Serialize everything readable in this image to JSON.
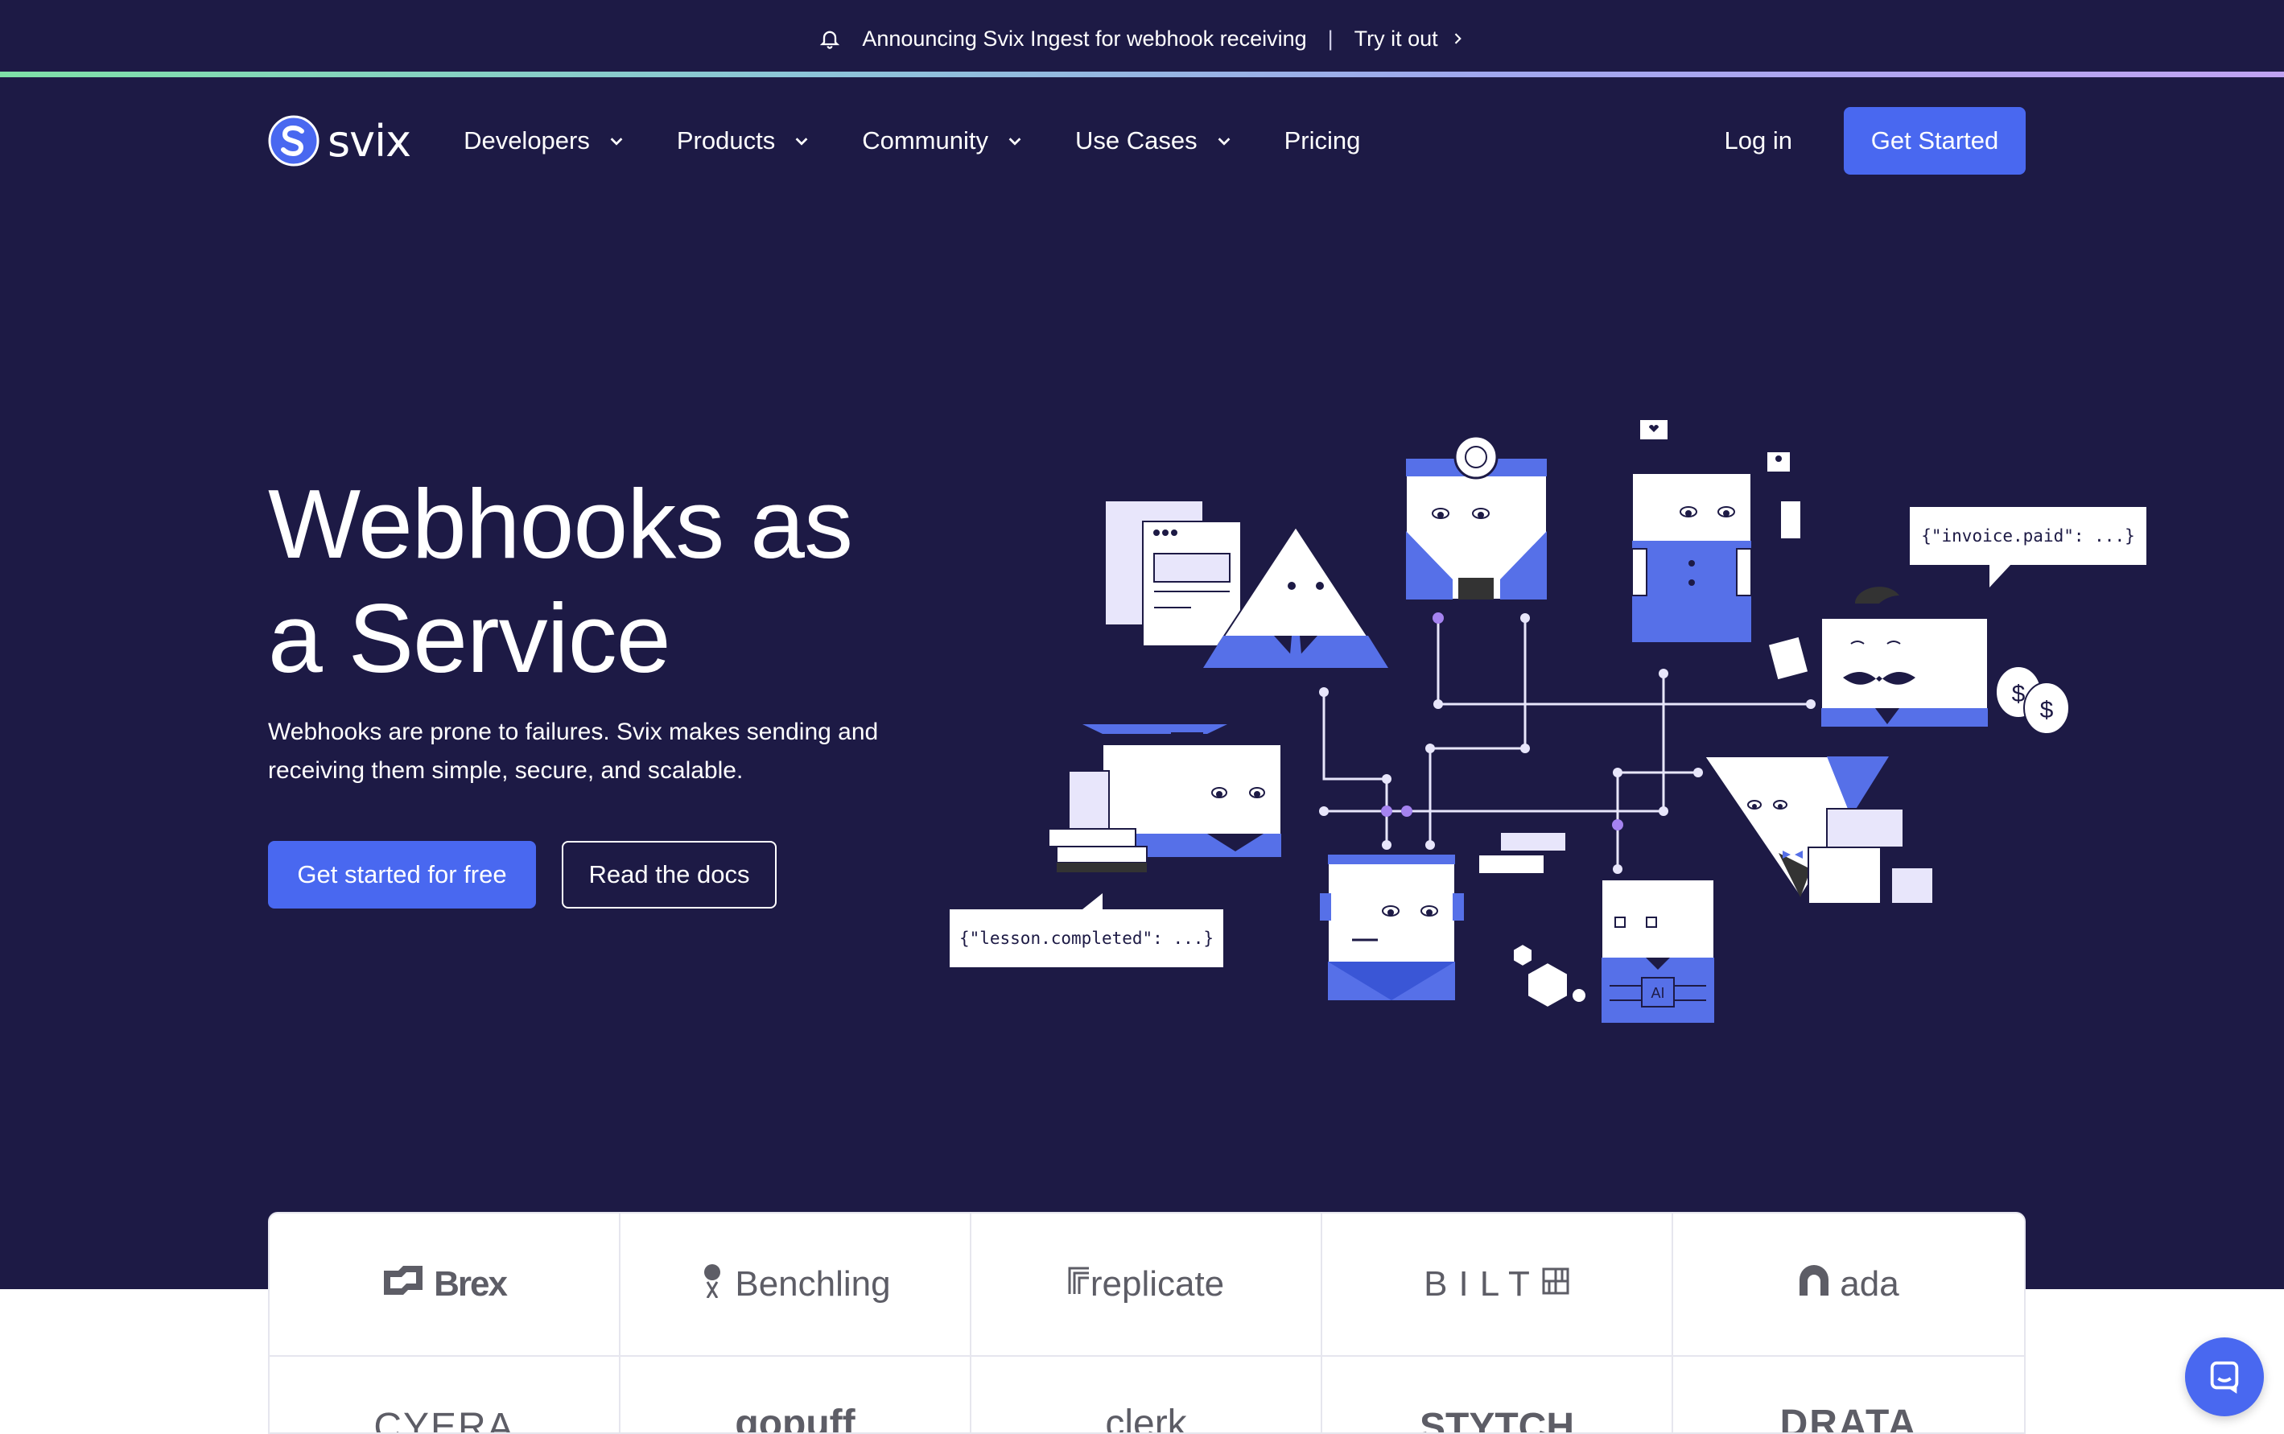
{
  "announcement": {
    "text": "Announcing Svix Ingest for webhook receiving",
    "separator": "|",
    "cta": "Try it out"
  },
  "nav": {
    "brand": "svix",
    "items": [
      {
        "label": "Developers",
        "dropdown": true
      },
      {
        "label": "Products",
        "dropdown": true
      },
      {
        "label": "Community",
        "dropdown": true
      },
      {
        "label": "Use Cases",
        "dropdown": true
      },
      {
        "label": "Pricing",
        "dropdown": false
      }
    ],
    "login": "Log in",
    "get_started": "Get Started"
  },
  "hero": {
    "title_line1": "Webhooks as",
    "title_line2": "a Service",
    "subtitle_line1": "Webhooks are prone to failures. Svix makes sending and",
    "subtitle_line2": "receiving them simple, secure, and scalable.",
    "primary_cta": "Get started for free",
    "secondary_cta": "Read the docs"
  },
  "illustration": {
    "bubble_invoice": "{\"invoice.paid\": ...}",
    "bubble_lesson": "{\"lesson.completed\": ...}",
    "chip_label": "AI",
    "money_symbol": "$"
  },
  "customers": {
    "row1": [
      "Brex",
      "Benchling",
      "replicate",
      "BILT",
      "ada"
    ],
    "row2": [
      "CYERA",
      "gopuff",
      "clerk",
      "STYTCH",
      "DRATA"
    ]
  },
  "colors": {
    "background": "#1d1a45",
    "accent": "#4968f0",
    "illustration_blue": "#5670e8",
    "illustration_lavender": "#e8e6fb"
  }
}
